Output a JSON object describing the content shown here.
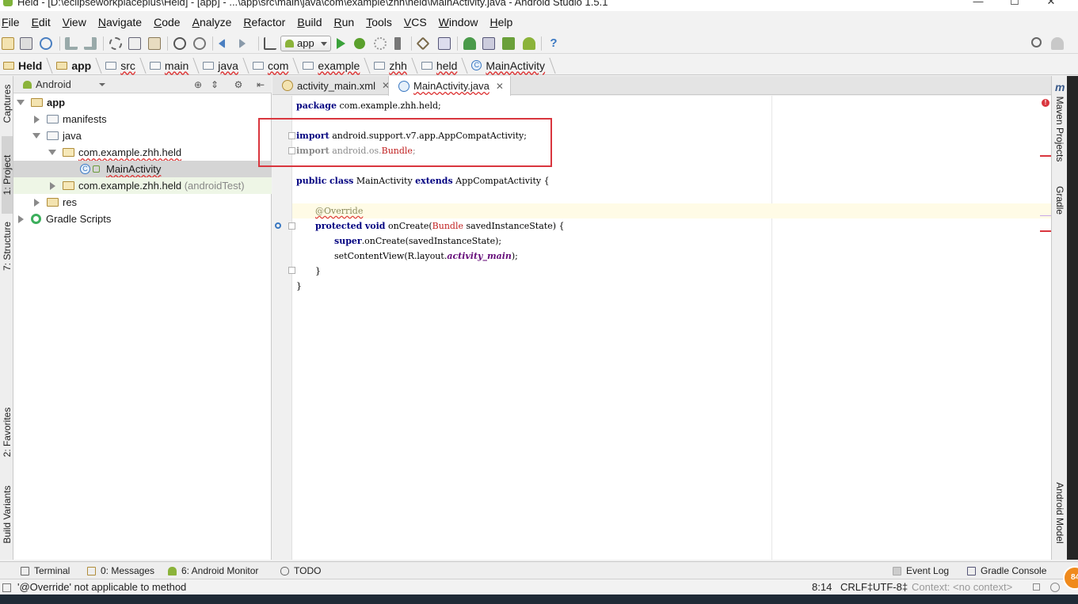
{
  "window": {
    "title": "Held - [D:\\eclipseworkplaceplus\\Held] - [app] - ...\\app\\src\\main\\java\\com\\example\\zhh\\held\\MainActivity.java - Android Studio 1.5.1",
    "minimize": "—",
    "maximize": "☐",
    "close": "✕"
  },
  "menu": [
    "File",
    "Edit",
    "View",
    "Navigate",
    "Code",
    "Analyze",
    "Refactor",
    "Build",
    "Run",
    "Tools",
    "VCS",
    "Window",
    "Help"
  ],
  "toolbar": {
    "run_config": "app"
  },
  "breadcrumb": [
    "Held",
    "app",
    "src",
    "main",
    "java",
    "com",
    "example",
    "zhh",
    "held",
    "MainActivity"
  ],
  "left_strip": {
    "captures": "Captures",
    "project": "1: Project",
    "structure": "7: Structure",
    "favorites": "2: Favorites",
    "build_variants": "Build Variants"
  },
  "right_strip": {
    "maven": "Maven Projects",
    "gradle": "Gradle",
    "android_model": "Android Model",
    "logo": "m"
  },
  "project_panel": {
    "view": "Android",
    "tree": [
      {
        "label": "app"
      },
      {
        "label": "manifests"
      },
      {
        "label": "java"
      },
      {
        "label": "com.example.zhh.held"
      },
      {
        "label": "MainActivity"
      },
      {
        "label": "com.example.zhh.held",
        "suffix": "(androidTest)"
      },
      {
        "label": "res"
      },
      {
        "label": "Gradle Scripts"
      }
    ]
  },
  "editor": {
    "tabs": [
      {
        "label": "activity_main.xml",
        "close": "✕"
      },
      {
        "label": "MainActivity.java",
        "close": "✕"
      }
    ],
    "code": {
      "l1_kw": "package",
      "l1_rest": " com.example.zhh.held;",
      "l2_kw": "import",
      "l2_rest": " android.support.v7.app.AppCompatActivity;",
      "l3_kw": "import",
      "l3_a": " android.os.",
      "l3_b": "Bundle",
      "l3_c": ";",
      "l4_kw1": "public",
      "l4_kw2": "class",
      "l4_name": " MainActivity ",
      "l4_kw3": "extends",
      "l4_rest": " AppCompatActivity {",
      "l5_ann": "@Override",
      "l6_kw1": "protected",
      "l6_kw2": "void",
      "l6_a": " onCreate(",
      "l6_b": "Bundle",
      "l6_c": " savedInstanceState) {",
      "l7_kw": "super",
      "l7_rest": ".onCreate(savedInstanceState);",
      "l8_a": "setContentView(R.layout.",
      "l8_b": "activity_main",
      "l8_c": ");",
      "l9": "}",
      "l10": "}"
    },
    "error_glyph": "!"
  },
  "bottom_tools": {
    "terminal": "Terminal",
    "messages": "0: Messages",
    "android_monitor": "6: Android Monitor",
    "todo": "TODO",
    "event_log": "Event Log",
    "gradle_console": "Gradle Console"
  },
  "status": {
    "message": "'@Override' not applicable to method",
    "position": "8:14",
    "line_sep": "CRLF‡",
    "encoding": "UTF-8‡",
    "context": "Context: <no context>"
  },
  "bubble": "84"
}
